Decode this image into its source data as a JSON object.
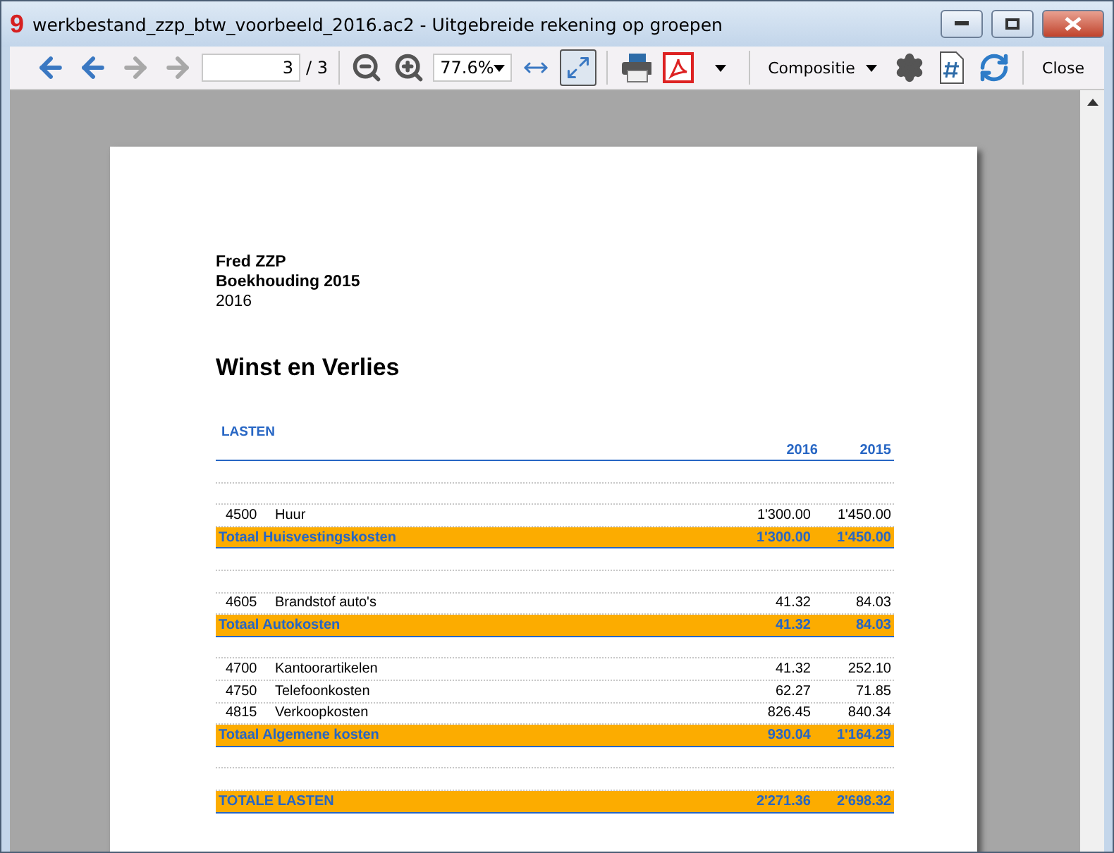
{
  "window": {
    "logo": "9",
    "title": "werkbestand_zzp_btw_voorbeeld_2016.ac2 - Uitgebreide rekening op groepen"
  },
  "toolbar": {
    "nav": [
      {
        "kind": "first",
        "disabled": false
      },
      {
        "kind": "prev",
        "disabled": false
      },
      {
        "kind": "next",
        "disabled": true
      },
      {
        "kind": "last",
        "disabled": true
      }
    ],
    "page_value": "3",
    "page_total": "/ 3",
    "zoom": "77.6%",
    "fit": [
      {
        "kind": "width",
        "selected": false
      },
      {
        "kind": "page",
        "selected": true
      }
    ],
    "layout": "Compositie",
    "close": "Close"
  },
  "report": {
    "company": "Fred ZZP",
    "subtitle": "Boekhouding 2015",
    "year": "2016",
    "title": "Winst en Verlies",
    "section": "LASTEN",
    "columns": [
      "2016",
      "2015"
    ],
    "rows": [
      {
        "kind": "blank"
      },
      {
        "kind": "blank"
      },
      {
        "kind": "account",
        "code": "4500",
        "name": "Huur",
        "values": [
          "1'300.00",
          "1'450.00"
        ]
      },
      {
        "kind": "total",
        "name": "Totaal Huisvestingskosten",
        "values": [
          "1'300.00",
          "1'450.00"
        ]
      },
      {
        "kind": "blank"
      },
      {
        "kind": "blank"
      },
      {
        "kind": "account",
        "code": "4605",
        "name": "Brandstof auto's",
        "values": [
          "41.32",
          "84.03"
        ]
      },
      {
        "kind": "total",
        "name": "Totaal Autokosten",
        "values": [
          "41.32",
          "84.03"
        ]
      },
      {
        "kind": "blank"
      },
      {
        "kind": "account",
        "code": "4700",
        "name": "Kantoorartikelen",
        "values": [
          "41.32",
          "252.10"
        ]
      },
      {
        "kind": "account",
        "code": "4750",
        "name": "Telefoonkosten",
        "values": [
          "62.27",
          "71.85"
        ]
      },
      {
        "kind": "account",
        "code": "4815",
        "name": "Verkoopkosten",
        "values": [
          "826.45",
          "840.34"
        ]
      },
      {
        "kind": "total",
        "name": "Totaal Algemene kosten",
        "values": [
          "930.04",
          "1'164.29"
        ]
      },
      {
        "kind": "blank"
      },
      {
        "kind": "blank"
      },
      {
        "kind": "total",
        "name": "TOTALE LASTEN",
        "values": [
          "2'271.36",
          "2'698.32"
        ]
      }
    ]
  }
}
